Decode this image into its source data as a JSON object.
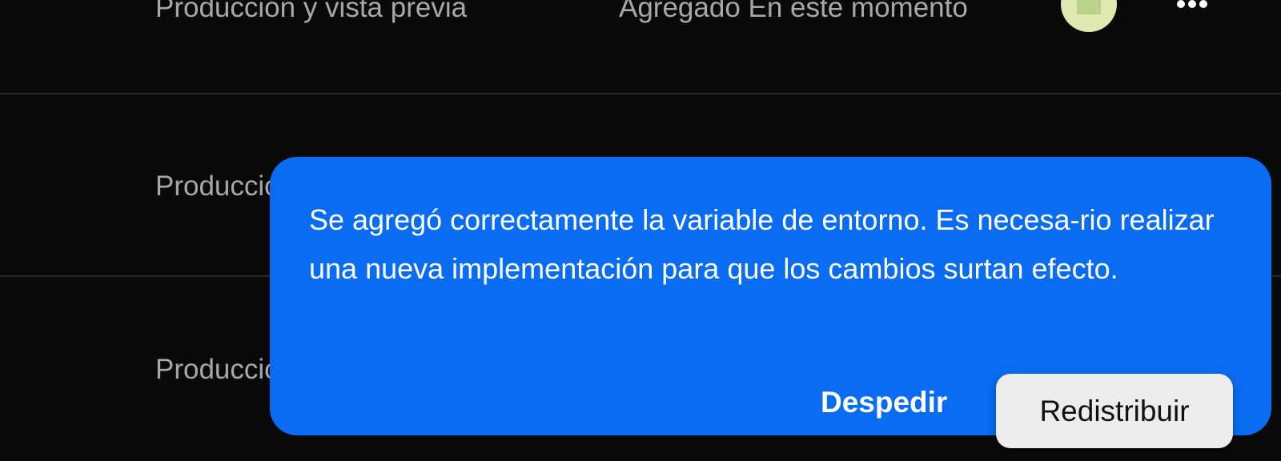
{
  "rows": [
    {
      "environments": "Producción y vista previa",
      "added": "Agregado En este momento"
    },
    {
      "environments": "Producción"
    },
    {
      "environments": "Producción"
    }
  ],
  "icons": {
    "avatar": "avatar-icon",
    "more": "more-horizontal-icon"
  },
  "toast": {
    "message": "Se agregó correctamente la variable de entorno. Es necesa-rio realizar una nueva implementación para que los cambios surtan efecto.",
    "dismiss_label": "Despedir",
    "redeploy_label": "Redistribuir",
    "accent_color": "#0a6cf2"
  }
}
